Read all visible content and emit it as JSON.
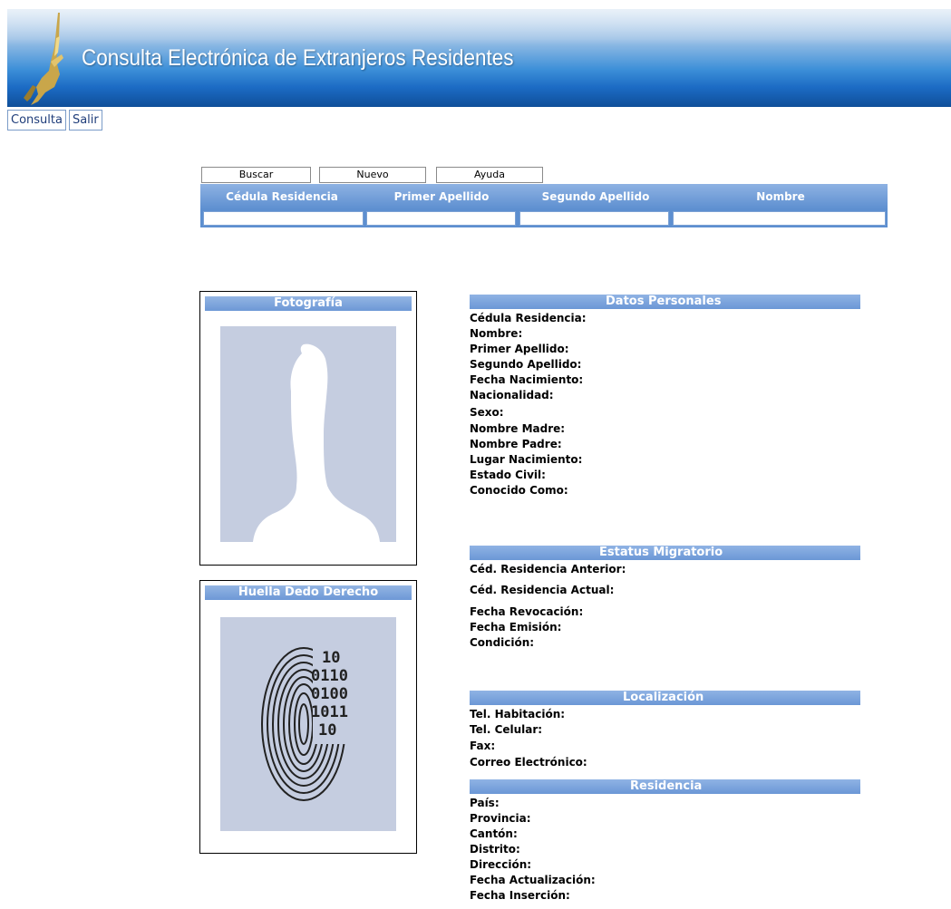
{
  "header": {
    "title": "Consulta Electrónica de Extranjeros Residentes"
  },
  "nav": {
    "items": [
      "Consulta",
      "Salir"
    ]
  },
  "search": {
    "buttons": {
      "buscar": "Buscar",
      "nuevo": "Nuevo",
      "ayuda": "Ayuda"
    },
    "columns": [
      "Cédula Residencia",
      "Primer Apellido",
      "Segundo Apellido",
      "Nombre"
    ]
  },
  "photo_panel": {
    "title": "Fotografía"
  },
  "fingerprint_panel": {
    "title": "Huella Dedo Derecho",
    "digits": [
      "10",
      "0110",
      "0100",
      "1011",
      "10"
    ]
  },
  "datos_personales": {
    "title": "Datos Personales",
    "fields": [
      "Cédula Residencia:",
      "Nombre:",
      "Primer Apellido:",
      "Segundo Apellido:",
      "Fecha Nacimiento:",
      "Nacionalidad:",
      "Sexo:",
      "Nombre Madre:",
      "Nombre Padre:",
      "Lugar Nacimiento:",
      "Estado Civil:",
      "Conocido Como:"
    ]
  },
  "estatus_migratorio": {
    "title": "Estatus Migratorio",
    "fields": [
      "Céd. Residencia Anterior:",
      "Céd. Residencia Actual:",
      "Fecha Revocación:",
      "Fecha Emisión:",
      "Condición:"
    ]
  },
  "localizacion": {
    "title": "Localización",
    "fields": [
      "Tel. Habitación:",
      "Tel. Celular:",
      "Fax:",
      "Correo Electrónico:"
    ]
  },
  "residencia": {
    "title": "Residencia",
    "fields": [
      "País:",
      "Provincia:",
      "Cantón:",
      "Distrito:",
      "Dirección:",
      "Fecha Actualización:",
      "Fecha Inserción:"
    ]
  },
  "colors": {
    "header_blue": "#1c6bc4",
    "section_blue": "#6b97d6",
    "placeholder_gray": "#c5cde0"
  }
}
